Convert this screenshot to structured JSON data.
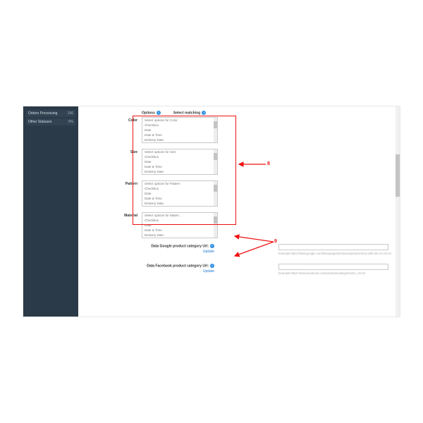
{
  "sidebar": {
    "items": [
      {
        "label": "Orders Processing",
        "count": "196"
      },
      {
        "label": "Other Statuses",
        "count": "0%"
      }
    ]
  },
  "header": {
    "options": "Options",
    "matching": "Select matching"
  },
  "rows": [
    {
      "label": "Color",
      "lines": [
        "Select options for Color",
        "Checkbox",
        "Date",
        "Date & Time",
        "Delivery Date"
      ]
    },
    {
      "label": "Size",
      "lines": [
        "Select options for Size",
        "Checkbox",
        "Date",
        "Date & Time",
        "Delivery Date"
      ]
    },
    {
      "label": "Pattern",
      "lines": [
        "Select options for Pattern",
        "Checkbox",
        "Date",
        "Date & Time",
        "Delivery Date"
      ]
    },
    {
      "label": "Material",
      "lines": [
        "Select options for Materi...",
        "Checkbox",
        "Date",
        "Date & Time",
        "Delivery Date"
      ]
    }
  ],
  "url1": {
    "label": "Data Google product category Url:",
    "update": "Update",
    "example": "Example:https://www.google.com/basepages/producttype/taxonomy-with-ids.en-US.txt"
  },
  "url2": {
    "label": "Data Facebook product category Url:",
    "update": "Update",
    "example": "Example:https://www.facebook.com/products/categories/en_US.txt"
  },
  "annotations": {
    "n8": "8",
    "n9": "9"
  }
}
